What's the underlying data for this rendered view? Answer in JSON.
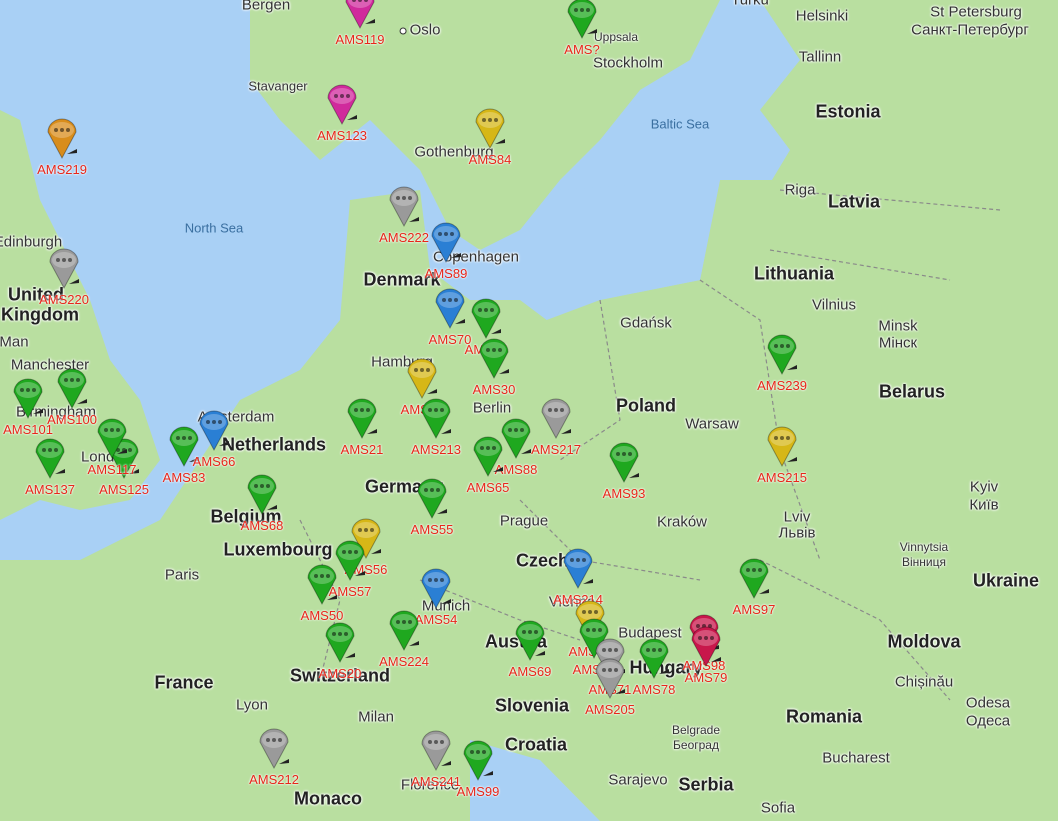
{
  "colors": {
    "sea": "#a9d0f5",
    "land": "#b9dfa0",
    "land_alt": "#c9e6b2",
    "border": "#8a8a8a",
    "marker_label": "#e8261a",
    "marker_green": "#1fa81f",
    "marker_blue": "#2a7fd4",
    "marker_yellow": "#d6b717",
    "marker_magenta": "#d02a9c",
    "marker_gray": "#9a9a9a",
    "marker_orange": "#d88d1c",
    "marker_red": "#c8174b"
  },
  "labels": {
    "bergen": "Bergen",
    "oslo": "Oslo",
    "uppsala": "Uppsala",
    "stockholm": "Stockholm",
    "turku": "Turku",
    "helsinki": "Helsinki",
    "st_petersburg": "St Petersburg",
    "st_petersburg_cyr": "Санкт-Петербург",
    "tallinn": "Tallinn",
    "stavanger": "Stavanger",
    "estonia": "Estonia",
    "baltic_sea": "Baltic Sea",
    "gothenburg": "Gothenburg",
    "riga": "Riga",
    "latvia": "Latvia",
    "north_sea": "North Sea",
    "edinburgh": "Edinburgh",
    "copenhagen": "Copenhagen",
    "denmark": "Denmark",
    "lithuania": "Lithuania",
    "vilnius": "Vilnius",
    "united": "United",
    "kingdom": "Kingdom",
    "isle_of_man": "Man",
    "manchester": "Manchester",
    "gdansk": "Gdańsk",
    "minsk": "Minsk",
    "minsk_cyr": "Мінск",
    "belarus": "Belarus",
    "birmingham": "Birmingham",
    "poland": "Poland",
    "warsaw": "Warsaw",
    "london": "London",
    "belgium": "Belgium",
    "germany": "Germany",
    "kyiv": "Kyiv",
    "kyiv_cyr": "Київ",
    "prague": "Prague",
    "krakow": "Kraków",
    "lviv": "Lviv",
    "lviv_cyr": "Львів",
    "luxembourg": "Luxembourg",
    "czechia": "Czechia",
    "vinnytsia": "Vinnytsia",
    "vinnytsia_cyr": "Вінниця",
    "paris": "Paris",
    "ukraine": "Ukraine",
    "vienna": "Vienna",
    "munich": "Munich",
    "austria": "Austria",
    "budapest": "Budapest",
    "moldova": "Moldova",
    "switzerland": "Switzerland",
    "hungary": "Hungary",
    "chisinau": "Chișinău",
    "france": "France",
    "lyon": "Lyon",
    "slovenia": "Slovenia",
    "odesa": "Odesa",
    "odesa_cyr": "Одеса",
    "milan": "Milan",
    "romania": "Romania",
    "croatia": "Croatia",
    "belgrade": "Belgrade",
    "belgrade_cyr": "Београд",
    "bucharest": "Bucharest",
    "florence": "Florence",
    "monaco": "Monaco",
    "sarajevo": "Sarajevo",
    "serbia": "Serbia",
    "sofia": "Sofia",
    "hamburg": "Hamburg",
    "amsterdam": "Amsterdam",
    "netherlands": "Netherlands",
    "berlin": "Berlin"
  },
  "markers": [
    {
      "id": "AMS119",
      "color": "magenta"
    },
    {
      "id": "AMS123",
      "color": "magenta"
    },
    {
      "id": "AMS?",
      "color": "green"
    },
    {
      "id": "AMS219",
      "color": "orange"
    },
    {
      "id": "AMS84",
      "color": "yellow"
    },
    {
      "id": "AMS222",
      "color": "gray"
    },
    {
      "id": "AMS220",
      "color": "gray"
    },
    {
      "id": "AMS89",
      "color": "blue"
    },
    {
      "id": "AMS75",
      "color": "green"
    },
    {
      "id": "AMS70",
      "color": "blue"
    },
    {
      "id": "AMS30",
      "color": "green"
    },
    {
      "id": "AMS239",
      "color": "green"
    },
    {
      "id": "AMS101",
      "color": "green"
    },
    {
      "id": "AMS100",
      "color": "green"
    },
    {
      "id": "AMS35",
      "color": "yellow"
    },
    {
      "id": "AMS213",
      "color": "green"
    },
    {
      "id": "AMS217",
      "color": "gray"
    },
    {
      "id": "AMS137",
      "color": "green"
    },
    {
      "id": "AMS125",
      "color": "green"
    },
    {
      "id": "AMS117",
      "color": "green"
    },
    {
      "id": "AMS83",
      "color": "green"
    },
    {
      "id": "AMS66",
      "color": "blue"
    },
    {
      "id": "AMS21",
      "color": "green"
    },
    {
      "id": "AMS88",
      "color": "green"
    },
    {
      "id": "AMS65",
      "color": "green"
    },
    {
      "id": "AMS215",
      "color": "yellow"
    },
    {
      "id": "AMS93",
      "color": "green"
    },
    {
      "id": "AMS55",
      "color": "green"
    },
    {
      "id": "AMS68",
      "color": "green"
    },
    {
      "id": "AMS56",
      "color": "yellow"
    },
    {
      "id": "AMS214",
      "color": "blue"
    },
    {
      "id": "AMS57",
      "color": "green"
    },
    {
      "id": "AMS50",
      "color": "green"
    },
    {
      "id": "AMS54",
      "color": "blue"
    },
    {
      "id": "AMS85",
      "color": "yellow"
    },
    {
      "id": "AMS97",
      "color": "green"
    },
    {
      "id": "AMS98",
      "color": "red"
    },
    {
      "id": "AMS90",
      "color": "green"
    },
    {
      "id": "AMS79",
      "color": "red"
    },
    {
      "id": "AMS69",
      "color": "green"
    },
    {
      "id": "AMS71",
      "color": "gray"
    },
    {
      "id": "AMS224",
      "color": "green"
    },
    {
      "id": "AMS20",
      "color": "green"
    },
    {
      "id": "AMS205",
      "color": "gray"
    },
    {
      "id": "AMS78",
      "color": "green"
    },
    {
      "id": "AMS241",
      "color": "gray"
    },
    {
      "id": "AMS99",
      "color": "green"
    },
    {
      "id": "AMS212",
      "color": "gray"
    }
  ]
}
